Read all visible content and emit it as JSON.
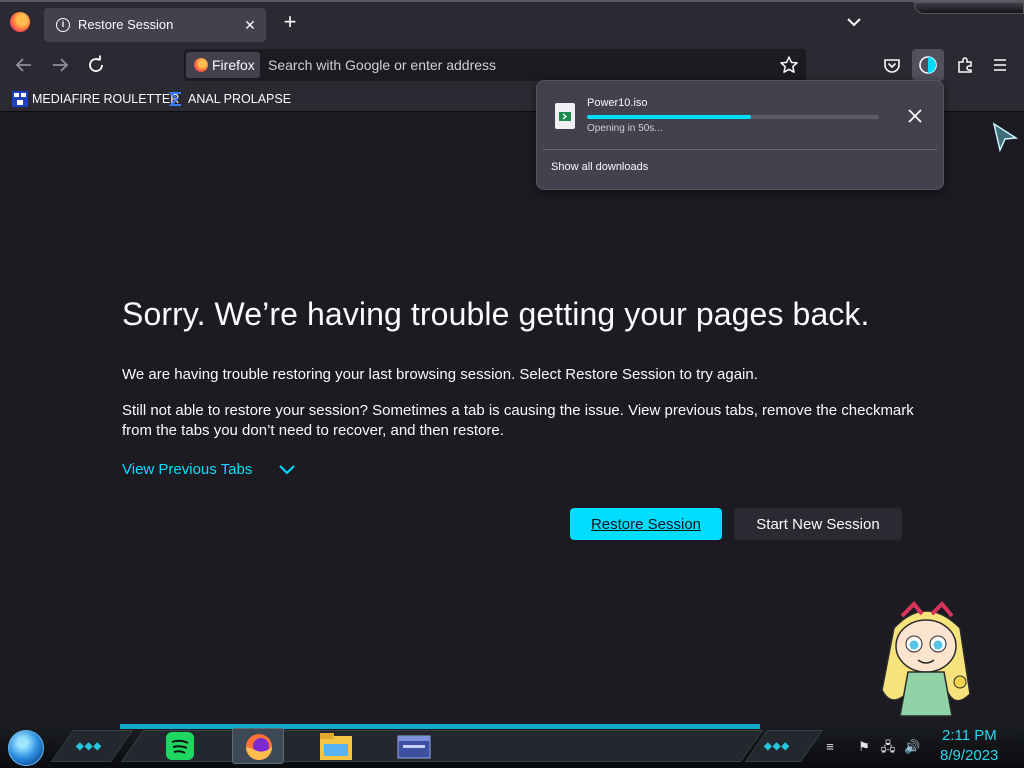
{
  "browser": {
    "tab": {
      "title": "Restore Session",
      "close_icon": "close-icon"
    },
    "identity_label": "Firefox",
    "urlbar": {
      "placeholder": "Search with Google or enter address",
      "value": ""
    },
    "bookmarks": [
      {
        "label": "MEDIAFIRE ROULETTER",
        "icon": "mediafire-icon"
      },
      {
        "label": "ANAL PROLAPSE",
        "icon": "sigma-icon"
      }
    ]
  },
  "downloads_panel": {
    "filename": "Power10.iso",
    "status": "Opening in 50s...",
    "progress": 0.56,
    "show_all_label": "Show all downloads"
  },
  "page": {
    "heading": "Sorry. We’re having trouble getting your pages back.",
    "paragraph1": "We are having trouble restoring your last browsing session. Select Restore Session to try again.",
    "paragraph2": "Still not able to restore your session? Sometimes a tab is causing the issue. View previous tabs, remove the checkmark from the tabs you don’t need to recover, and then restore.",
    "view_previous_tabs": "View Previous Tabs",
    "restore_button": "Restore Session",
    "new_session_button": "Start New Session"
  },
  "taskbar": {
    "apps": [
      "spotify-icon",
      "firefox-icon",
      "file-explorer-icon",
      "window-app-icon"
    ],
    "time": "2:11 PM",
    "date": "8/9/2023"
  },
  "colors": {
    "accent": "#00ddff",
    "background": "#1c1b22",
    "toolbar": "#2b2a33",
    "panel": "#42414d",
    "clock": "#2bd7ee"
  }
}
